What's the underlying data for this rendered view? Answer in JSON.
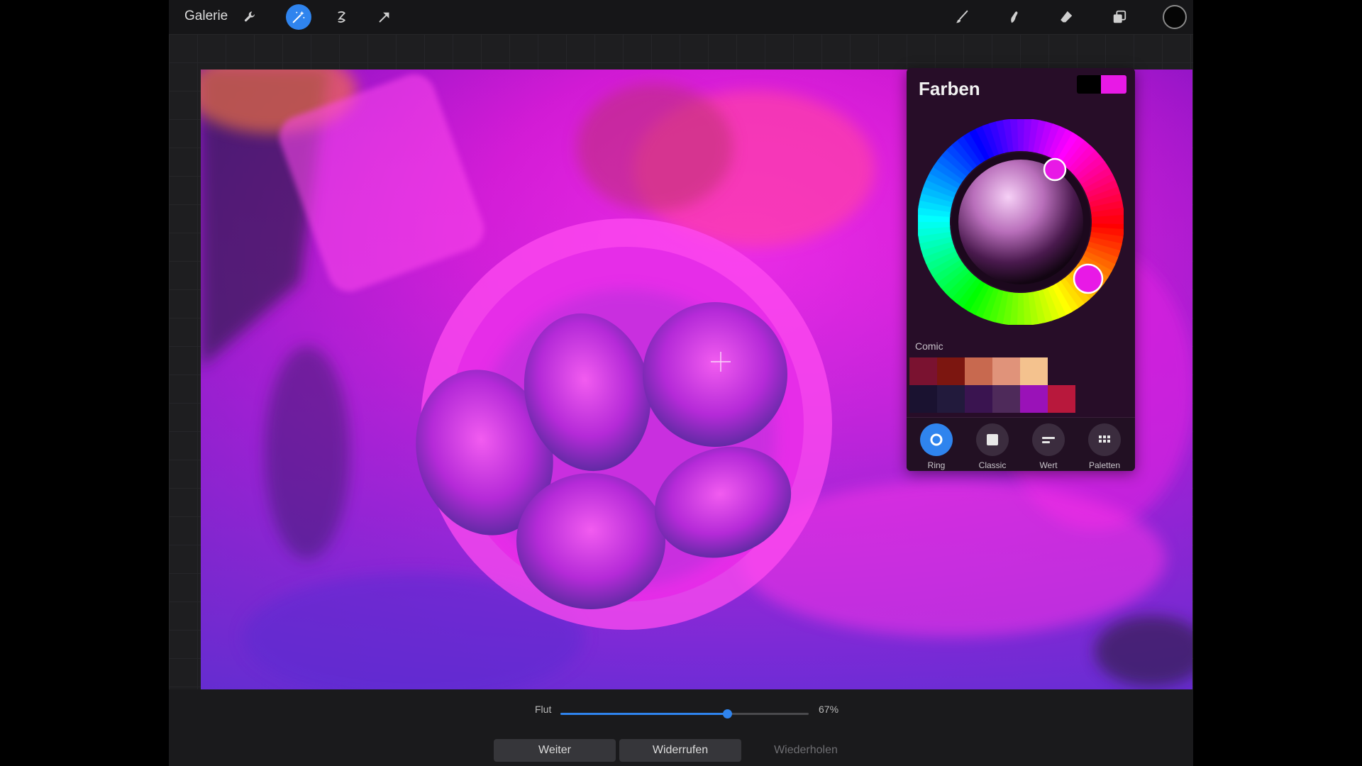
{
  "topbar": {
    "gallery_label": "Galerie",
    "left_tools": [
      {
        "name": "wrench-icon",
        "label": "Aktionen"
      },
      {
        "name": "magic-wand-icon",
        "label": "Anpassungen",
        "active": true
      },
      {
        "name": "selection-icon",
        "label": "Auswahl"
      },
      {
        "name": "transform-arrow-icon",
        "label": "Transformieren"
      }
    ],
    "right_tools": [
      {
        "name": "brush-icon",
        "label": "Malen"
      },
      {
        "name": "smudge-icon",
        "label": "Verwischen"
      },
      {
        "name": "eraser-icon",
        "label": "Radieren"
      },
      {
        "name": "layers-icon",
        "label": "Ebenen"
      }
    ],
    "current_color": "#050505"
  },
  "color_panel": {
    "title": "Farben",
    "secondary_color": "#000000",
    "primary_color": "#e819e6",
    "palette_name": "Comic",
    "swatches_row1": [
      "#7a1230",
      "#7c1610",
      "#c8694f",
      "#e0937a",
      "#f4c28e"
    ],
    "swatches_row2": [
      "#1a1230",
      "#221a3c",
      "#3a1450",
      "#4e2a5a",
      "#9a12b8",
      "#b8183c"
    ],
    "modes": [
      {
        "name": "ring",
        "label": "Ring",
        "active": true
      },
      {
        "name": "classic",
        "label": "Classic",
        "active": false
      },
      {
        "name": "value",
        "label": "Wert",
        "active": false
      },
      {
        "name": "palettes",
        "label": "Paletten",
        "active": false
      }
    ]
  },
  "bottom": {
    "flow_label": "Flut",
    "flow_value_text": "67%",
    "flow_value": 0.67,
    "buttons": [
      {
        "name": "continue-button",
        "label": "Weiter",
        "enabled": true
      },
      {
        "name": "undo-button",
        "label": "Widerrufen",
        "enabled": true
      },
      {
        "name": "redo-button",
        "label": "Wiederholen",
        "enabled": false
      }
    ]
  },
  "colors": {
    "accent": "#2f84ee",
    "panel_bg": "#270d28"
  }
}
